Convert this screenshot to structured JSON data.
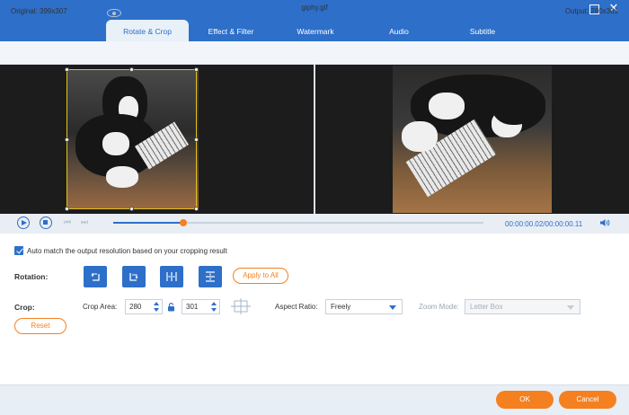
{
  "tabs": [
    {
      "label": "Rotate & Crop",
      "active": true
    },
    {
      "label": "Effect & Filter",
      "active": false
    },
    {
      "label": "Watermark",
      "active": false
    },
    {
      "label": "Audio",
      "active": false
    },
    {
      "label": "Subtitle",
      "active": false
    }
  ],
  "window": {
    "maximize_icon": "maximize-icon",
    "close_glyph": "✕"
  },
  "info": {
    "original": "Original: 399x307",
    "filename": "giphy.gif",
    "output": "Output: 280x301"
  },
  "playback": {
    "current": "00:00:00.02",
    "separator": "/",
    "total": "00:00:00.11",
    "progress": 0.19,
    "prev_glyph": "⏮",
    "next_glyph": "⏭"
  },
  "auto_match": {
    "checked": true,
    "label": "Auto match the output resolution based on your cropping result"
  },
  "rotation": {
    "label": "Rotation:",
    "apply_all": "Apply to All"
  },
  "crop": {
    "label": "Crop:",
    "area_label": "Crop Area:",
    "width": "280",
    "height": "301",
    "aspect_label": "Aspect Ratio:",
    "aspect_value": "Freely",
    "zoom_label": "Zoom Mode:",
    "zoom_value": "Letter Box",
    "reset": "Reset"
  },
  "footer": {
    "ok": "OK",
    "cancel": "Cancel"
  },
  "colors": {
    "accent": "#2d6fc9",
    "action": "#f5801f",
    "crop_frame": "#e3c21a"
  }
}
